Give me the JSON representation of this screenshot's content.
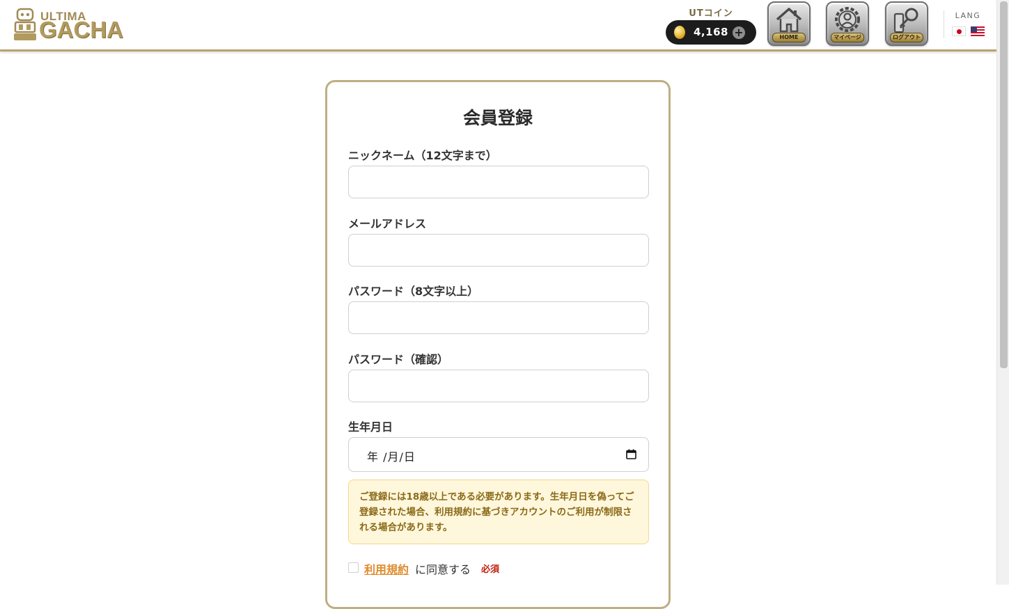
{
  "header": {
    "logo": {
      "line1": "ULTIMA",
      "line2": "GACHA"
    },
    "coin": {
      "label": "UTコイン",
      "amount": "4,168",
      "add_symbol": "+"
    },
    "nav": [
      {
        "caption": "HOME",
        "icon": "house-icon"
      },
      {
        "caption": "マイページ",
        "icon": "user-gear-icon"
      },
      {
        "caption": "ログアウト",
        "icon": "key-icon"
      }
    ],
    "lang": {
      "label": "LANG",
      "options": [
        "jp-flag-icon",
        "us-flag-icon"
      ]
    }
  },
  "form": {
    "title": "会員登録",
    "fields": {
      "nickname": {
        "label": "ニックネーム（12文字まで）",
        "value": ""
      },
      "email": {
        "label": "メールアドレス",
        "value": ""
      },
      "password": {
        "label": "パスワード（8文字以上）",
        "value": ""
      },
      "password_confirm": {
        "label": "パスワード（確認）",
        "value": ""
      },
      "birthdate": {
        "label": "生年月日",
        "placeholder": "年 /月/日"
      }
    },
    "notice": "ご登録には18歳以上である必要があります。生年月日を偽ってご登録された場合、利用規約に基づきアカウントのご利用が制限される場合があります。",
    "agree": {
      "link_text": "利用規約",
      "text": "に同意する",
      "required": "必須"
    }
  },
  "colors": {
    "accent_gold": "#b9a36e",
    "notice_bg": "#fff7dc",
    "notice_text": "#8a6a18",
    "link": "#e08a2a",
    "required": "#c0210f"
  }
}
